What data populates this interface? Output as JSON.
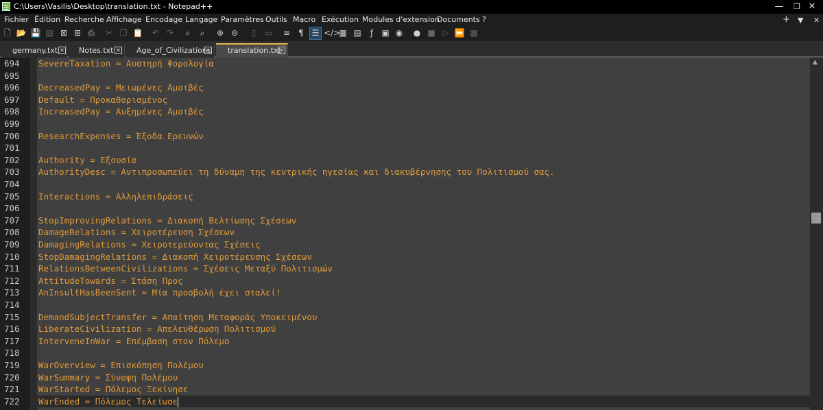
{
  "window": {
    "title": "C:\\Users\\Vasilis\\Desktop\\translation.txt - Notepad++",
    "minimize": "—",
    "maximize": "❐",
    "close": "✕"
  },
  "menu": {
    "items": [
      "Fichier",
      "Édition",
      "Recherche",
      "Affichage",
      "Encodage",
      "Langage",
      "Paramètres",
      "Outils",
      "Macro",
      "Exécution",
      "Modules d'extension",
      "Documents",
      "?"
    ],
    "right": [
      "+",
      "▼",
      "✕"
    ]
  },
  "toolbar": {
    "icons": [
      "new-file-icon",
      "open-file-icon",
      "save-icon",
      "save-all-icon",
      "close-icon",
      "close-all-icon",
      "print-icon",
      "cut-icon",
      "copy-icon",
      "paste-icon",
      "undo-icon",
      "redo-icon",
      "find-icon",
      "replace-icon",
      "zoom-in-icon",
      "zoom-out-icon",
      "sync-vertical-icon",
      "sync-horizontal-icon",
      "word-wrap-icon",
      "show-all-chars-icon",
      "indent-guide-icon",
      "xml-tag-icon",
      "document-map-icon",
      "document-list-icon",
      "function-list-icon",
      "folder-workspace-icon",
      "monitoring-icon",
      "record-macro-icon",
      "stop-record-icon",
      "play-macro-icon",
      "play-multiple-icon",
      "save-macro-icon"
    ]
  },
  "tabs": [
    {
      "label": "germany.txt",
      "active": false
    },
    {
      "label": "Notes.txt",
      "active": false
    },
    {
      "label": "Age_of_Civilizations",
      "active": false
    },
    {
      "label": "translation.txt",
      "active": true
    }
  ],
  "editor": {
    "text_color": "#e09a3a",
    "lines": [
      {
        "n": "694",
        "text": "SevereTaxation = Αυστηρή Φορολογία"
      },
      {
        "n": "695",
        "text": ""
      },
      {
        "n": "696",
        "text": "DecreasedPay = Μειωμένες Αμοιβές"
      },
      {
        "n": "697",
        "text": "Default = Προκαθορισμένος"
      },
      {
        "n": "698",
        "text": "IncreasedPay = Αυξημένες Αμοιβές"
      },
      {
        "n": "699",
        "text": ""
      },
      {
        "n": "700",
        "text": "ResearchExpenses = Έξοδα Ερευνών"
      },
      {
        "n": "701",
        "text": ""
      },
      {
        "n": "702",
        "text": "Authority = Εξουσία"
      },
      {
        "n": "703",
        "text": "AuthorityDesc = Αντιπροσωπεύει τη δύναμη της κεντρικής ηγεσίας και διακυβέρνησης του Πολιτισμού σας."
      },
      {
        "n": "704",
        "text": ""
      },
      {
        "n": "705",
        "text": "Interactions = Αλληλεπιδράσεις"
      },
      {
        "n": "706",
        "text": ""
      },
      {
        "n": "707",
        "text": "StopImprovingRelations = Διακοπή Βελτίωσης Σχέσεων"
      },
      {
        "n": "708",
        "text": "DamageRelations = Χειροτέρευση Σχέσεων"
      },
      {
        "n": "709",
        "text": "DamagingRelations = Χειροτερεύοντας Σχέσεις"
      },
      {
        "n": "710",
        "text": "StopDamagingRelations = Διακοπή Χειροτέρευσης Σχέσεων"
      },
      {
        "n": "711",
        "text": "RelationsBetweenCivilizations = Σχέσεις Μεταξύ Πολιτισμών"
      },
      {
        "n": "712",
        "text": "AttitudeTowards = Στάση Προς"
      },
      {
        "n": "713",
        "text": "AnInsultHasBeenSent = Μία προσβολή έχει σταλεί!"
      },
      {
        "n": "714",
        "text": ""
      },
      {
        "n": "715",
        "text": "DemandSubjectTransfer = Απαίτηση Μεταφοράς Υποκειμένου"
      },
      {
        "n": "716",
        "text": "LiberateCivilization = Απελευθέρωση Πολιτισμού"
      },
      {
        "n": "717",
        "text": "InterveneInWar = Επέμβαση στον Πόλεμο"
      },
      {
        "n": "718",
        "text": ""
      },
      {
        "n": "719",
        "text": "WarOverview = Επισκόπηση Πολέμου"
      },
      {
        "n": "720",
        "text": "WarSummary = Σύνοψη Πολέμου"
      },
      {
        "n": "721",
        "text": "WarStarted = Πόλεμος Ξεκίνησε"
      },
      {
        "n": "722",
        "text": "WarEnded = Πόλεμος Τελείωσε"
      }
    ]
  }
}
